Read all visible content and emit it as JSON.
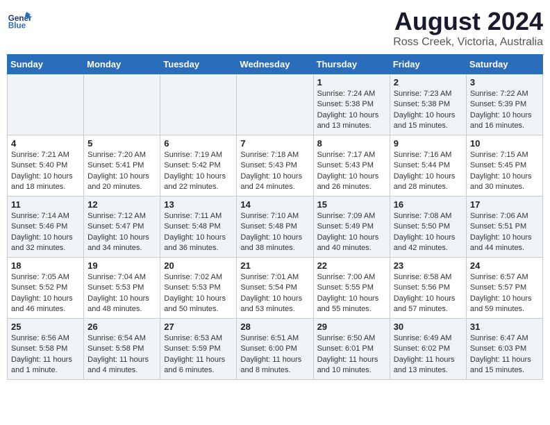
{
  "logo": {
    "line1": "General",
    "line2": "Blue"
  },
  "title": "August 2024",
  "location": "Ross Creek, Victoria, Australia",
  "days_of_week": [
    "Sunday",
    "Monday",
    "Tuesday",
    "Wednesday",
    "Thursday",
    "Friday",
    "Saturday"
  ],
  "weeks": [
    [
      {
        "num": "",
        "info": ""
      },
      {
        "num": "",
        "info": ""
      },
      {
        "num": "",
        "info": ""
      },
      {
        "num": "",
        "info": ""
      },
      {
        "num": "1",
        "info": "Sunrise: 7:24 AM\nSunset: 5:38 PM\nDaylight: 10 hours\nand 13 minutes."
      },
      {
        "num": "2",
        "info": "Sunrise: 7:23 AM\nSunset: 5:38 PM\nDaylight: 10 hours\nand 15 minutes."
      },
      {
        "num": "3",
        "info": "Sunrise: 7:22 AM\nSunset: 5:39 PM\nDaylight: 10 hours\nand 16 minutes."
      }
    ],
    [
      {
        "num": "4",
        "info": "Sunrise: 7:21 AM\nSunset: 5:40 PM\nDaylight: 10 hours\nand 18 minutes."
      },
      {
        "num": "5",
        "info": "Sunrise: 7:20 AM\nSunset: 5:41 PM\nDaylight: 10 hours\nand 20 minutes."
      },
      {
        "num": "6",
        "info": "Sunrise: 7:19 AM\nSunset: 5:42 PM\nDaylight: 10 hours\nand 22 minutes."
      },
      {
        "num": "7",
        "info": "Sunrise: 7:18 AM\nSunset: 5:43 PM\nDaylight: 10 hours\nand 24 minutes."
      },
      {
        "num": "8",
        "info": "Sunrise: 7:17 AM\nSunset: 5:43 PM\nDaylight: 10 hours\nand 26 minutes."
      },
      {
        "num": "9",
        "info": "Sunrise: 7:16 AM\nSunset: 5:44 PM\nDaylight: 10 hours\nand 28 minutes."
      },
      {
        "num": "10",
        "info": "Sunrise: 7:15 AM\nSunset: 5:45 PM\nDaylight: 10 hours\nand 30 minutes."
      }
    ],
    [
      {
        "num": "11",
        "info": "Sunrise: 7:14 AM\nSunset: 5:46 PM\nDaylight: 10 hours\nand 32 minutes."
      },
      {
        "num": "12",
        "info": "Sunrise: 7:12 AM\nSunset: 5:47 PM\nDaylight: 10 hours\nand 34 minutes."
      },
      {
        "num": "13",
        "info": "Sunrise: 7:11 AM\nSunset: 5:48 PM\nDaylight: 10 hours\nand 36 minutes."
      },
      {
        "num": "14",
        "info": "Sunrise: 7:10 AM\nSunset: 5:48 PM\nDaylight: 10 hours\nand 38 minutes."
      },
      {
        "num": "15",
        "info": "Sunrise: 7:09 AM\nSunset: 5:49 PM\nDaylight: 10 hours\nand 40 minutes."
      },
      {
        "num": "16",
        "info": "Sunrise: 7:08 AM\nSunset: 5:50 PM\nDaylight: 10 hours\nand 42 minutes."
      },
      {
        "num": "17",
        "info": "Sunrise: 7:06 AM\nSunset: 5:51 PM\nDaylight: 10 hours\nand 44 minutes."
      }
    ],
    [
      {
        "num": "18",
        "info": "Sunrise: 7:05 AM\nSunset: 5:52 PM\nDaylight: 10 hours\nand 46 minutes."
      },
      {
        "num": "19",
        "info": "Sunrise: 7:04 AM\nSunset: 5:53 PM\nDaylight: 10 hours\nand 48 minutes."
      },
      {
        "num": "20",
        "info": "Sunrise: 7:02 AM\nSunset: 5:53 PM\nDaylight: 10 hours\nand 50 minutes."
      },
      {
        "num": "21",
        "info": "Sunrise: 7:01 AM\nSunset: 5:54 PM\nDaylight: 10 hours\nand 53 minutes."
      },
      {
        "num": "22",
        "info": "Sunrise: 7:00 AM\nSunset: 5:55 PM\nDaylight: 10 hours\nand 55 minutes."
      },
      {
        "num": "23",
        "info": "Sunrise: 6:58 AM\nSunset: 5:56 PM\nDaylight: 10 hours\nand 57 minutes."
      },
      {
        "num": "24",
        "info": "Sunrise: 6:57 AM\nSunset: 5:57 PM\nDaylight: 10 hours\nand 59 minutes."
      }
    ],
    [
      {
        "num": "25",
        "info": "Sunrise: 6:56 AM\nSunset: 5:58 PM\nDaylight: 11 hours\nand 1 minute."
      },
      {
        "num": "26",
        "info": "Sunrise: 6:54 AM\nSunset: 5:58 PM\nDaylight: 11 hours\nand 4 minutes."
      },
      {
        "num": "27",
        "info": "Sunrise: 6:53 AM\nSunset: 5:59 PM\nDaylight: 11 hours\nand 6 minutes."
      },
      {
        "num": "28",
        "info": "Sunrise: 6:51 AM\nSunset: 6:00 PM\nDaylight: 11 hours\nand 8 minutes."
      },
      {
        "num": "29",
        "info": "Sunrise: 6:50 AM\nSunset: 6:01 PM\nDaylight: 11 hours\nand 10 minutes."
      },
      {
        "num": "30",
        "info": "Sunrise: 6:49 AM\nSunset: 6:02 PM\nDaylight: 11 hours\nand 13 minutes."
      },
      {
        "num": "31",
        "info": "Sunrise: 6:47 AM\nSunset: 6:03 PM\nDaylight: 11 hours\nand 15 minutes."
      }
    ]
  ]
}
